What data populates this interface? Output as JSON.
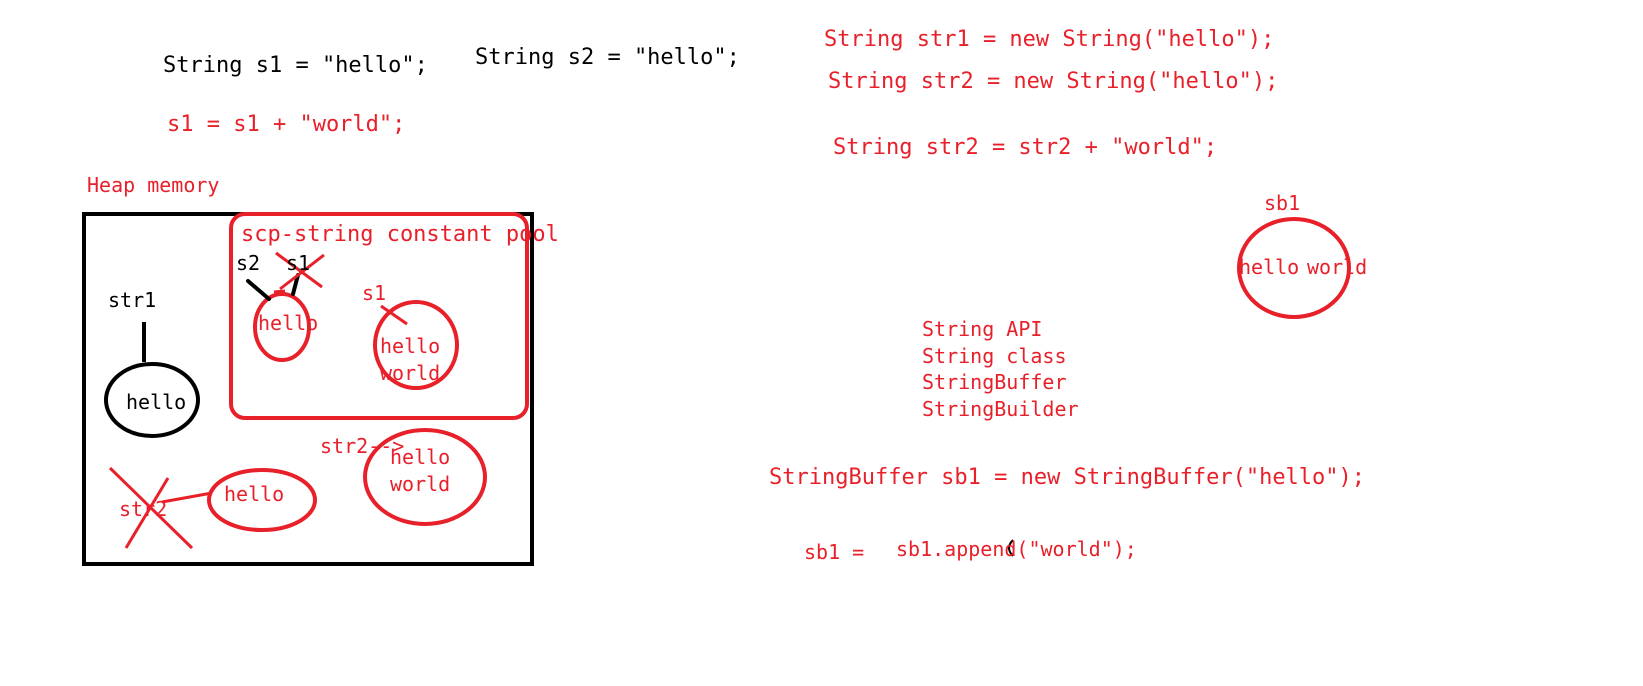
{
  "colors": {
    "ink_red": "#e8202a",
    "ink_black": "#000000",
    "background": "#ffffff"
  },
  "code": {
    "s1_decl": "String s1 = \"hello\";",
    "s2_decl": "String s2 = \"hello\";",
    "s1_concat": "s1 = s1 + \"world\";",
    "str1_decl": "String str1 = new String(\"hello\");",
    "str2_decl": "String str2 = new String(\"hello\");",
    "str2_concat": "String str2 = str2 + \"world\";",
    "sb1_decl": "StringBuffer sb1 = new StringBuffer(\"hello\");",
    "sb1_assign": "sb1 =",
    "sb1_append": "sb1.append(\"world\");"
  },
  "heap": {
    "title": "Heap memory",
    "scp_title": "scp-string constant pool",
    "labels": {
      "s2": "s2",
      "s1_crossed": "s1",
      "s1_new": "s1",
      "str1": "str1",
      "str2_crossed": "str2",
      "str2_arrow": "str2-->"
    },
    "objects": {
      "scp_hello": "hello",
      "scp_hello_world_1": "hello",
      "scp_hello_world_2": "world",
      "str1_hello": "hello",
      "str2_hello": "hello",
      "str2_hello_world_1": "hello",
      "str2_hello_world_2": "world"
    }
  },
  "api_list": [
    "String API",
    "String class",
    "StringBuffer",
    "StringBuilder"
  ],
  "sb_object": {
    "label": "sb1",
    "word1": "hello",
    "word2": "world"
  }
}
